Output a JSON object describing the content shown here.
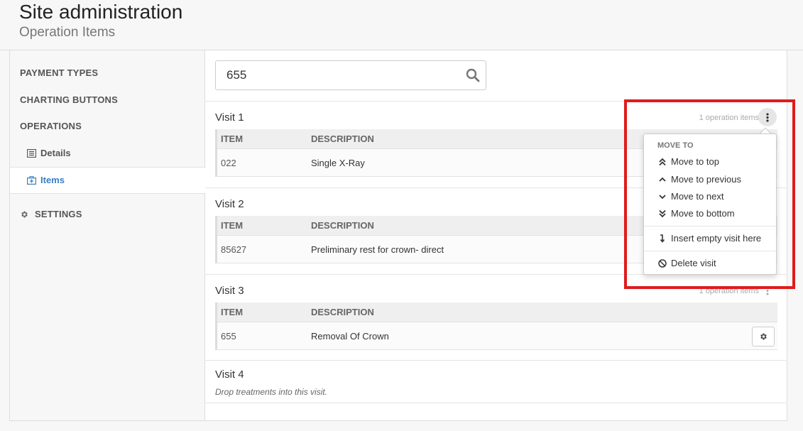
{
  "header": {
    "title": "Site administration",
    "subtitle": "Operation Items"
  },
  "sidebar": {
    "payment_types": "PAYMENT TYPES",
    "charting_buttons": "CHARTING BUTTONS",
    "operations": "OPERATIONS",
    "details": "Details",
    "items": "Items",
    "settings": "SETTINGS"
  },
  "search": {
    "value": "655"
  },
  "table_headers": {
    "item": "ITEM",
    "description": "DESCRIPTION"
  },
  "visits": [
    {
      "title": "Visit 1",
      "meta": "1 operation items",
      "item": "022",
      "description": "Single X-Ray"
    },
    {
      "title": "Visit 2",
      "item": "85627",
      "description": "Preliminary rest for crown- direct"
    },
    {
      "title": "Visit 3",
      "meta": "1 operation items",
      "item": "655",
      "description": "Removal Of Crown"
    },
    {
      "title": "Visit 4",
      "hint": "Drop treatments into this visit."
    }
  ],
  "menu": {
    "header": "MOVE TO",
    "move_top": "Move to top",
    "move_previous": "Move to previous",
    "move_next": "Move to next",
    "move_bottom": "Move to bottom",
    "insert_empty": "Insert empty visit here",
    "delete_visit": "Delete visit"
  },
  "colors": {
    "accent": "#3a7fc1",
    "highlight": "#e01b1b"
  }
}
